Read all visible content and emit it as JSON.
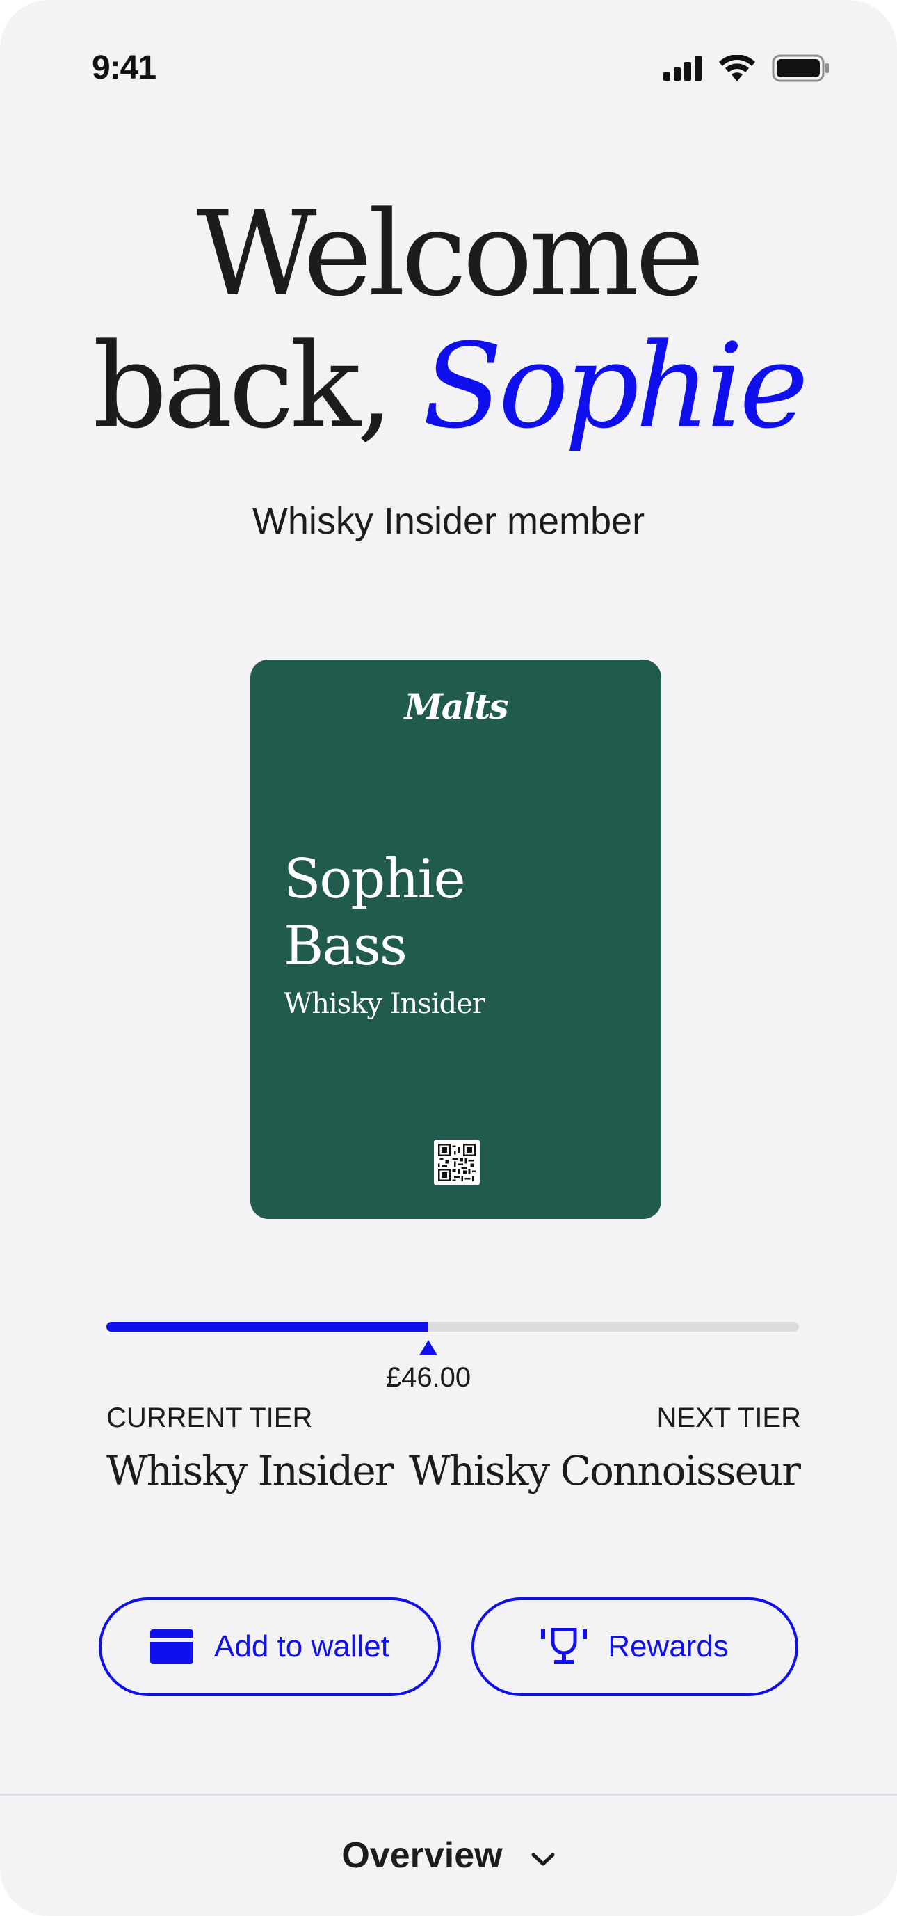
{
  "status_bar": {
    "time": "9:41",
    "icons": [
      "cellular-signal-icon",
      "wifi-icon",
      "battery-icon"
    ]
  },
  "header": {
    "greeting_line1": "Welcome",
    "greeting_line2_prefix": "back,",
    "user_first_name": "Sophie",
    "membership_subtitle": "Whisky Insider member"
  },
  "card": {
    "brand": "Malts",
    "first_name": "Sophie",
    "last_name": "Bass",
    "tier": "Whisky Insider",
    "background_color": "#215b4d",
    "qr_icon": "qr-code-icon"
  },
  "progress": {
    "fraction": 0.465,
    "amount": "£46.00",
    "current_tier_label": "CURRENT TIER",
    "current_tier": "Whisky Insider",
    "next_tier_label": "NEXT TIER",
    "next_tier": "Whisky Connoisseur"
  },
  "actions": {
    "wallet_label": "Add to wallet",
    "wallet_icon": "wallet-card-icon",
    "rewards_label": "Rewards",
    "rewards_icon": "trophy-icon"
  },
  "bottom_bar": {
    "label": "Overview",
    "icon": "chevron-down-icon"
  },
  "colors": {
    "accent": "#1010ee",
    "background": "#f3f3f6",
    "text": "#1c1c1c",
    "card": "#215b4d"
  }
}
